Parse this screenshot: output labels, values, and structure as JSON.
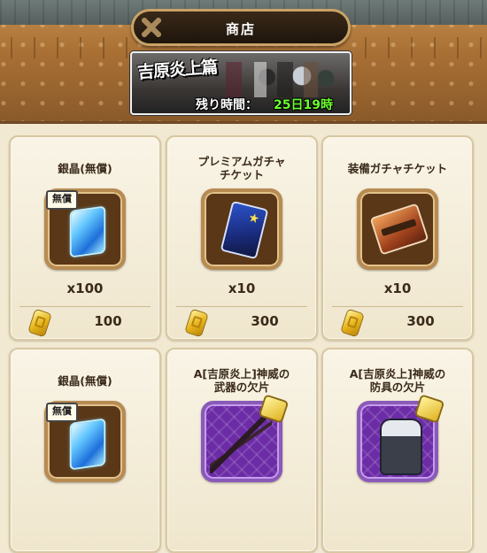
{
  "shop": {
    "title": "商店",
    "banner": {
      "event_logo": "吉原炎上篇",
      "remaining_label": "残り時間：",
      "remaining_value": "25日19時"
    }
  },
  "items": [
    {
      "name": "銀晶(無償)",
      "tag": "無償",
      "quantity": "x100",
      "price": "100",
      "icon": "blue-crystal-icon"
    },
    {
      "name": "プレミアムガチャ\nチケット",
      "quantity": "x10",
      "price": "300",
      "icon": "premium-gacha-ticket-icon"
    },
    {
      "name": "装備ガチャチケット",
      "quantity": "x10",
      "price": "300",
      "icon": "equipment-gacha-ticket-icon"
    },
    {
      "name": "銀晶(無償)",
      "tag": "無償",
      "icon": "blue-crystal-icon"
    },
    {
      "name": "A[吉原炎上]神威の\n武器の欠片",
      "icon": "weapon-fragment-icon"
    },
    {
      "name": "A[吉原炎上]神威の\n防具の欠片",
      "icon": "armor-fragment-icon"
    }
  ],
  "colors": {
    "header_brown": "#a86f34",
    "card_bg": "#f9f4e6",
    "remaining_green": "#6bff2e",
    "fragment_purple": "#6c2ca6"
  }
}
